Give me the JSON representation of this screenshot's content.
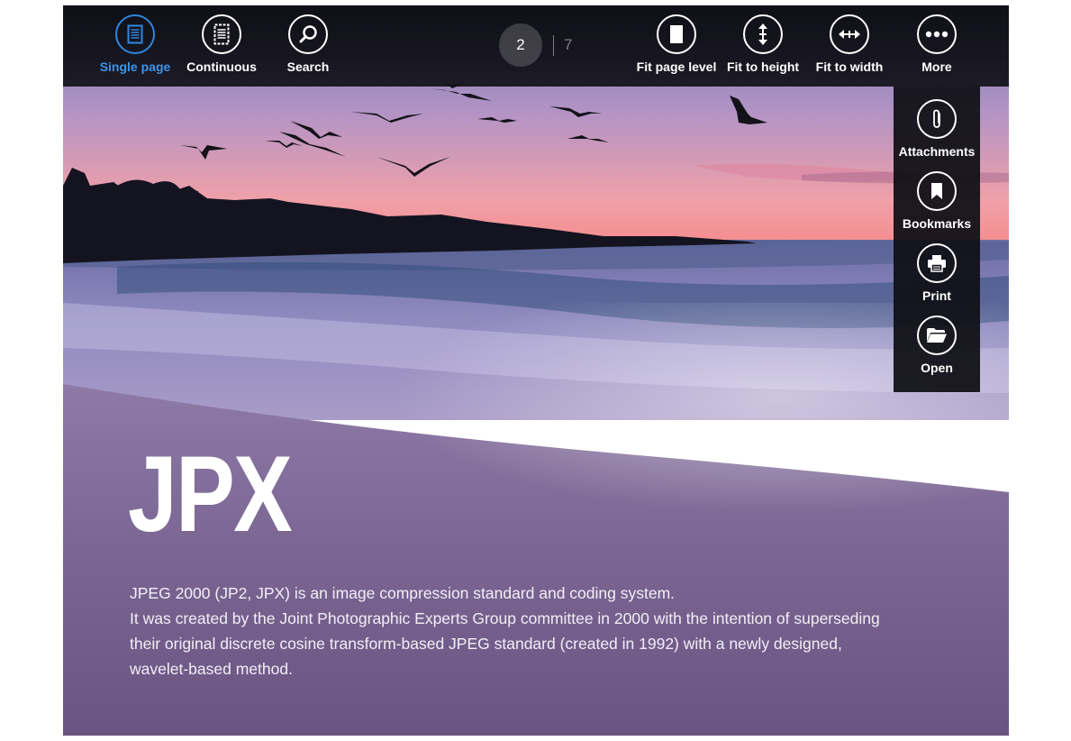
{
  "toolbar": {
    "single_page": "Single page",
    "continuous": "Continuous",
    "search": "Search",
    "fit_page_level": "Fit page level",
    "fit_to_height": "Fit to height",
    "fit_to_width": "Fit to width",
    "more": "More"
  },
  "pager": {
    "current": "2",
    "total": "7"
  },
  "more_menu": {
    "attachments": "Attachments",
    "bookmarks": "Bookmarks",
    "print": "Print",
    "open": "Open"
  },
  "document": {
    "title": "JPX",
    "line1": "JPEG 2000 (JP2, JPX) is an image compression standard and coding system.",
    "line2": "It was created by the Joint Photographic Experts Group committee in 2000 with the intention of superseding their original discrete cosine transform-based JPEG standard (created in 1992) with a newly designed, wavelet-based method."
  },
  "colors": {
    "accent": "#2e86de",
    "appbar": "#121218",
    "text": "#ffffff"
  }
}
